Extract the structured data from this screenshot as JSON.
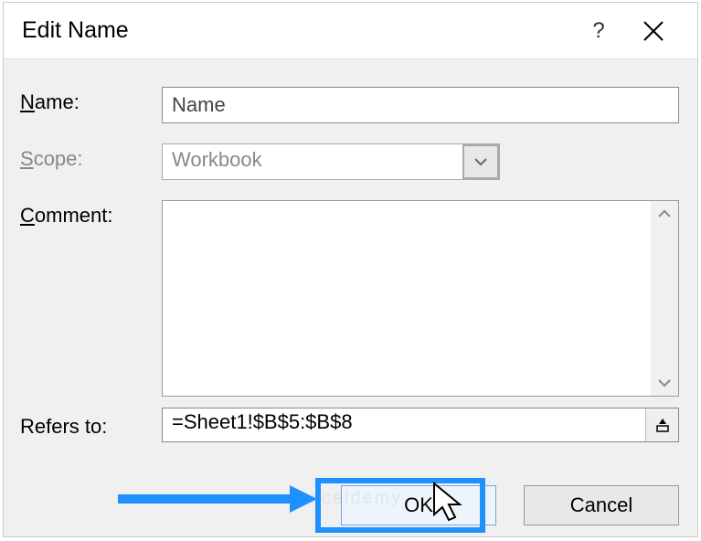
{
  "titlebar": {
    "title": "Edit Name"
  },
  "labels": {
    "name": "ame:",
    "name_u": "N",
    "scope": "cope:",
    "scope_u": "S",
    "comment": "omment:",
    "comment_u": "C",
    "refers": "efers to:",
    "refers_u": "R"
  },
  "fields": {
    "name_value": "Name",
    "scope_value": "Workbook",
    "comment_value": "",
    "refers_value": "=Sheet1!$B$5:$B$8"
  },
  "buttons": {
    "ok": "OK",
    "cancel": "Cancel"
  },
  "watermark": "exceldemy"
}
